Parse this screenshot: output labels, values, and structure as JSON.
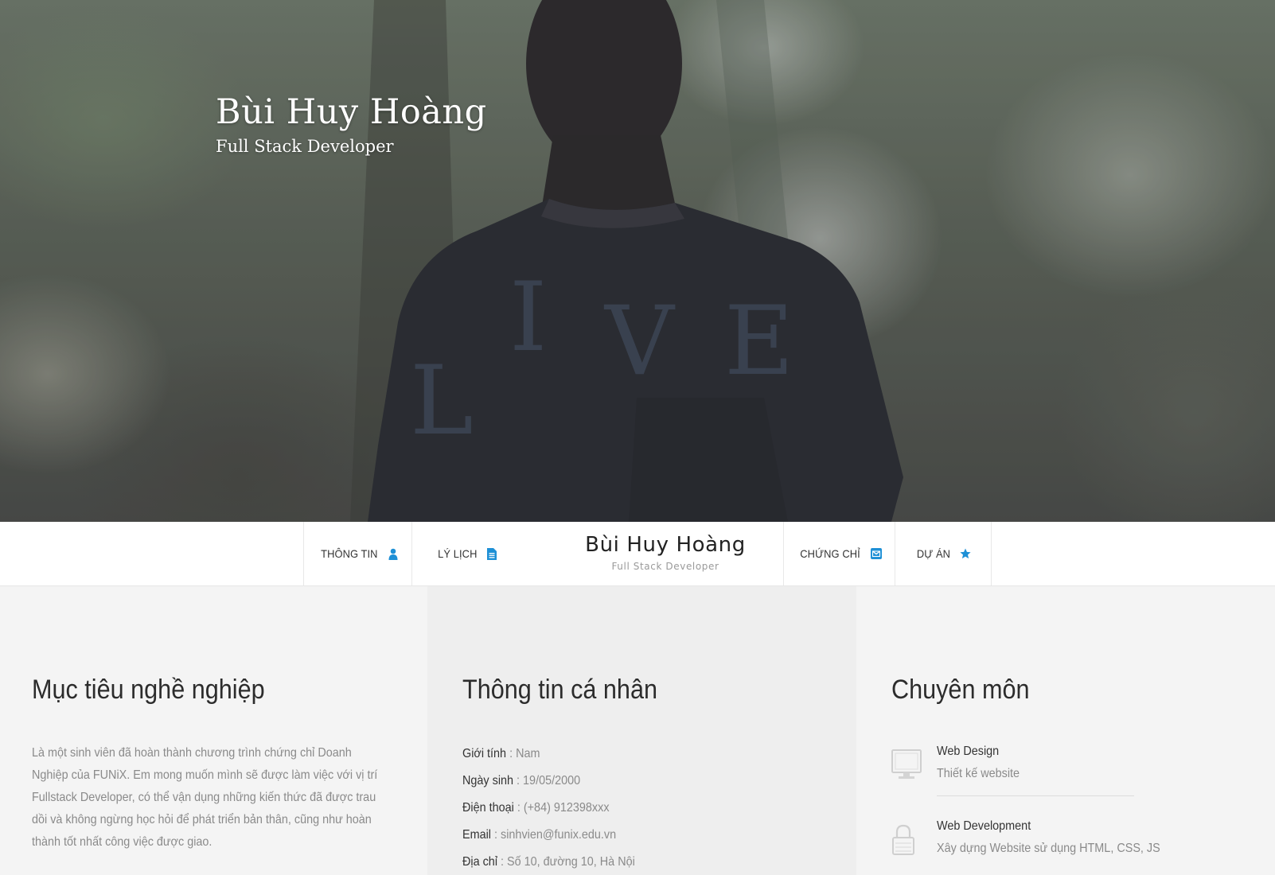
{
  "hero": {
    "name": "Bùi Huy Hoàng",
    "role": "Full Stack Developer"
  },
  "nav": {
    "items": [
      {
        "label": "THÔNG TIN",
        "icon": "user-icon"
      },
      {
        "label": "LÝ LỊCH",
        "icon": "file-icon"
      },
      {
        "label": "CHỨNG CHỈ",
        "icon": "envelope-icon"
      },
      {
        "label": "DỰ ÁN",
        "icon": "star-icon"
      }
    ],
    "brand_name": "Bùi Huy Hoàng",
    "brand_role": "Full Stack Developer",
    "icon_color": "#1e90d6"
  },
  "objective": {
    "title": "Mục tiêu nghề nghiệp",
    "text": "Là một sinh viên đã hoàn thành chương trình chứng chỉ Doanh Nghiệp của FUNiX. Em mong muốn mình sẽ được làm việc với vị trí Fullstack Developer, có thể vận dụng những kiến thức đã được trau dồi và không ngừng học hỏi để phát triển bản thân, cũng như hoàn thành tốt nhất công việc được giao."
  },
  "personal": {
    "title": "Thông tin cá nhân",
    "rows": [
      {
        "key": "Giới tính",
        "sep": " : ",
        "value": "Nam"
      },
      {
        "key": "Ngày sinh",
        "sep": " : ",
        "value": "19/05/2000"
      },
      {
        "key": "Điện thoại",
        "sep": " : ",
        "value": "(+84) 912398xxx"
      },
      {
        "key": "Email",
        "sep": " : ",
        "value": "sinhvien@funix.edu.vn"
      },
      {
        "key": "Địa chỉ",
        "sep": " : ",
        "value": "Số 10, đường 10, Hà Nội"
      }
    ]
  },
  "expertise": {
    "title": "Chuyên môn",
    "items": [
      {
        "title": "Web Design",
        "desc": "Thiết kế website",
        "icon": "monitor-icon"
      },
      {
        "title": "Web Development",
        "desc": "Xây dựng Website sử dụng HTML, CSS, JS",
        "icon": "lock-icon"
      }
    ]
  }
}
